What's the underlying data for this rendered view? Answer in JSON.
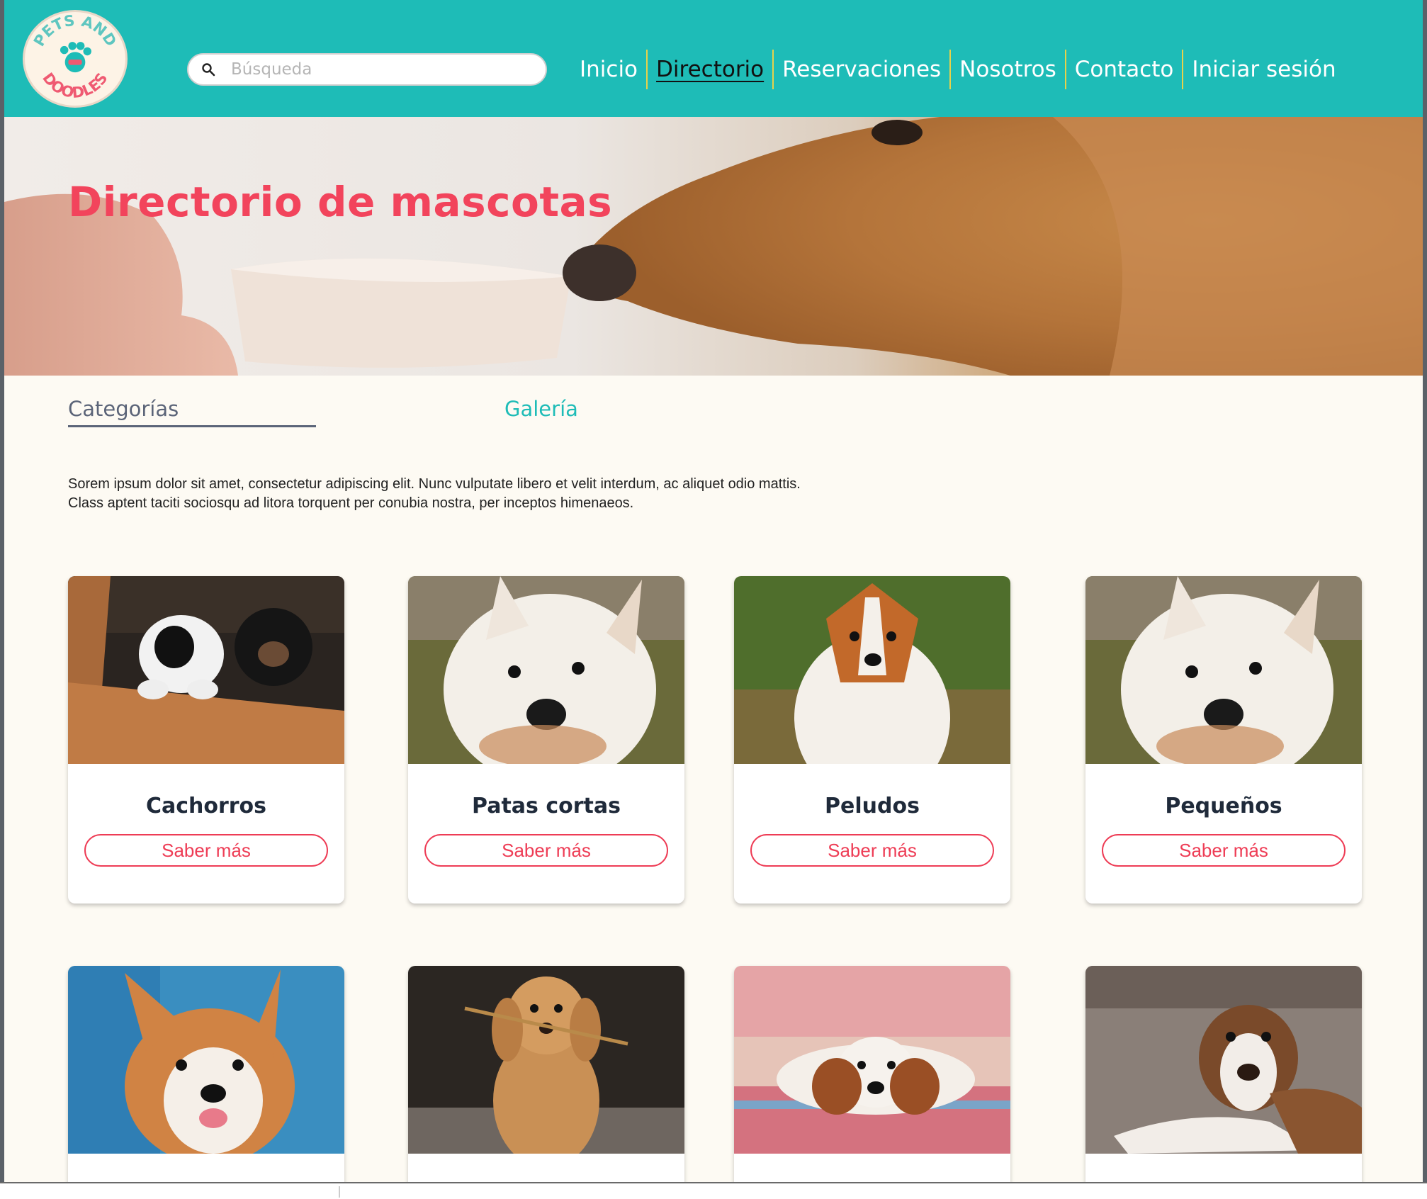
{
  "header": {
    "logo_text": "PETS AND DOODLES",
    "search": {
      "placeholder": "Búsqueda",
      "value": ""
    },
    "nav": [
      {
        "label": "Inicio",
        "active": false
      },
      {
        "label": "Directorio",
        "active": true
      },
      {
        "label": "Reservaciones",
        "active": false
      },
      {
        "label": "Nosotros",
        "active": false
      },
      {
        "label": "Contacto",
        "active": false
      },
      {
        "label": "Iniciar sesión",
        "active": false
      }
    ]
  },
  "hero": {
    "title": "Directorio de mascotas"
  },
  "tabs": {
    "categorias": "Categorías",
    "galeria": "Galería"
  },
  "intro": {
    "line1": "Sorem ipsum dolor sit amet, consectetur adipiscing elit. Nunc vulputate libero et velit interdum, ac aliquet odio mattis.",
    "line2": "Class aptent taciti sociosqu ad litora torquent per conubia nostra, per inceptos himenaeos."
  },
  "categories": [
    {
      "title": "Cachorros",
      "button": "Saber más"
    },
    {
      "title": "Patas cortas",
      "button": "Saber más"
    },
    {
      "title": "Peludos",
      "button": "Saber más"
    },
    {
      "title": "Pequeños",
      "button": "Saber más"
    }
  ],
  "colors": {
    "brand_teal": "#1ebcb7",
    "accent_red": "#f2445c",
    "background": "#fdfaf3"
  }
}
